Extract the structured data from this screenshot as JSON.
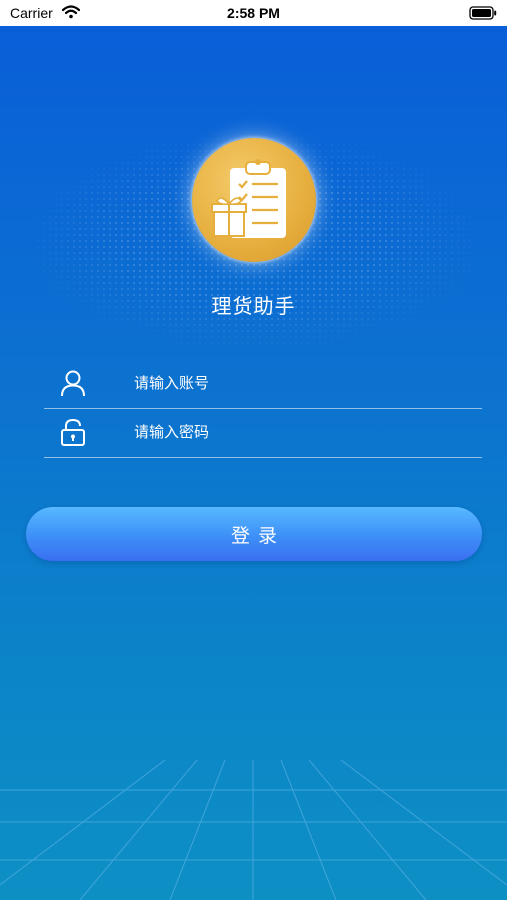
{
  "status_bar": {
    "carrier": "Carrier",
    "time": "2:58 PM",
    "wifi_icon": "wifi-icon",
    "battery_icon": "battery-icon"
  },
  "app": {
    "title": "理货助手",
    "logo_icon": "clipboard-gift-icon",
    "logo_color": "#e6ae3d",
    "background_color": "#0a6ad6"
  },
  "form": {
    "account": {
      "placeholder": "请输入账号",
      "value": "",
      "icon": "user-icon"
    },
    "password": {
      "placeholder": "请输入密码",
      "value": "",
      "icon": "lock-icon"
    },
    "login_label": "登录"
  }
}
